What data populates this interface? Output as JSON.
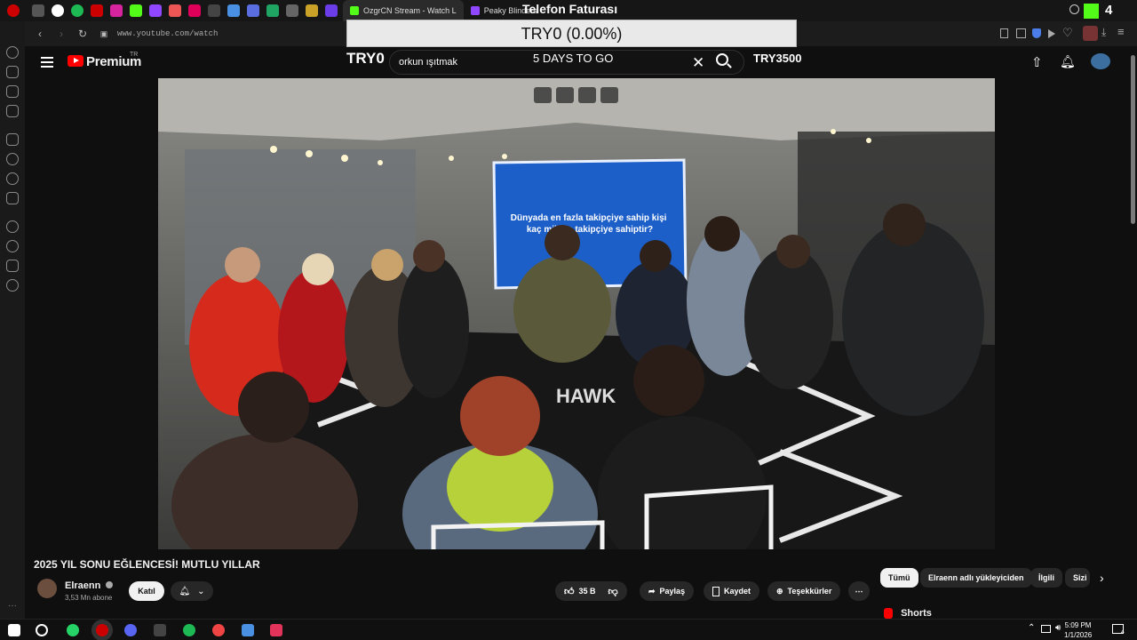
{
  "tabs": {
    "stream_tab": "OzgrCN Stream - Watch L",
    "peaky_tab": "Peaky Blinders"
  },
  "address_bar": {
    "url": "www.youtube.com/watch"
  },
  "youtube_header": {
    "logo_text": "Premium",
    "region": "TR",
    "search_query": "orkun ışıtmak"
  },
  "overlay": {
    "title": "Telefon Faturası",
    "box_text": "TRY0 (0.00%)",
    "left_amount": "TRY0",
    "countdown": "5 DAYS TO GO",
    "goal": "TRY3500"
  },
  "video": {
    "title": "2025 YIL SONU EĞLENCESİ! MUTLU YILLAR",
    "screen_text": "Dünyada en fazla takipçiye sahip kişi kaç milyon takipçiye sahiptir?"
  },
  "channel": {
    "name": "Elraenn",
    "subscribers": "3,53 Mn abone",
    "join_label": "Katıl"
  },
  "actions": {
    "like_count": "35 B",
    "share_label": "Paylaş",
    "save_label": "Kaydet",
    "thanks_label": "Teşekkürler"
  },
  "chips": [
    "Tümü",
    "Elraenn adlı yükleyiciden",
    "İlgili",
    "Sizi"
  ],
  "shorts_label": "Shorts",
  "taskbar": {
    "time": "5:09 PM",
    "date": "1/1/2026",
    "notif_count": "4"
  },
  "colors": {
    "yt_red": "#ff0000",
    "bg": "#0f0f0f",
    "chip_bg": "#272727"
  }
}
